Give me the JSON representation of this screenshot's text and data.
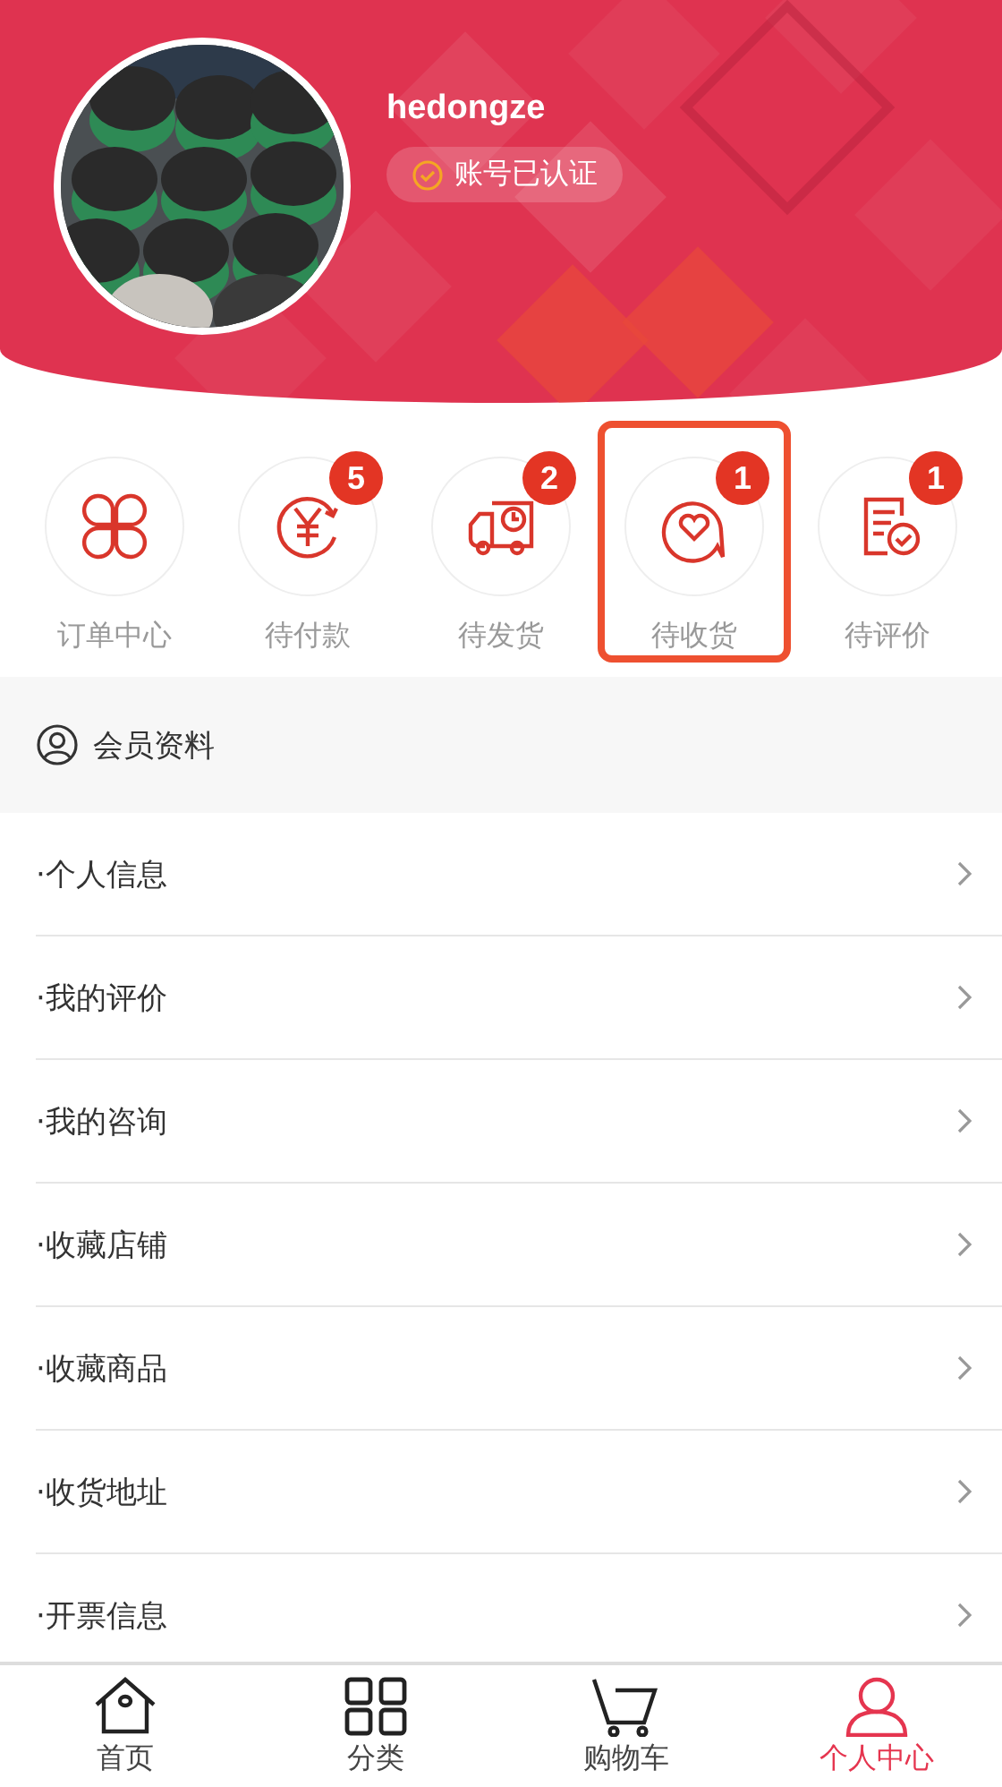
{
  "profile": {
    "username": "hedongze",
    "verified_label": "账号已认证"
  },
  "orders": [
    {
      "label": "订单中心",
      "highlighted": false
    },
    {
      "label": "待付款",
      "count": "5",
      "highlighted": false
    },
    {
      "label": "待发货",
      "count": "2",
      "highlighted": false
    },
    {
      "label": "待收货",
      "count": "1",
      "highlighted": true
    },
    {
      "label": "待评价",
      "count": "1",
      "highlighted": false
    }
  ],
  "section": {
    "title": "会员资料"
  },
  "menu": [
    "·个人信息",
    "·我的评价",
    "·我的咨询",
    "·收藏店铺",
    "·收藏商品",
    "·收货地址",
    "·开票信息"
  ],
  "tabs": [
    {
      "label": "首页",
      "selected": false
    },
    {
      "label": "分类",
      "selected": false
    },
    {
      "label": "购物车",
      "selected": false
    },
    {
      "label": "个人中心",
      "selected": true
    }
  ]
}
